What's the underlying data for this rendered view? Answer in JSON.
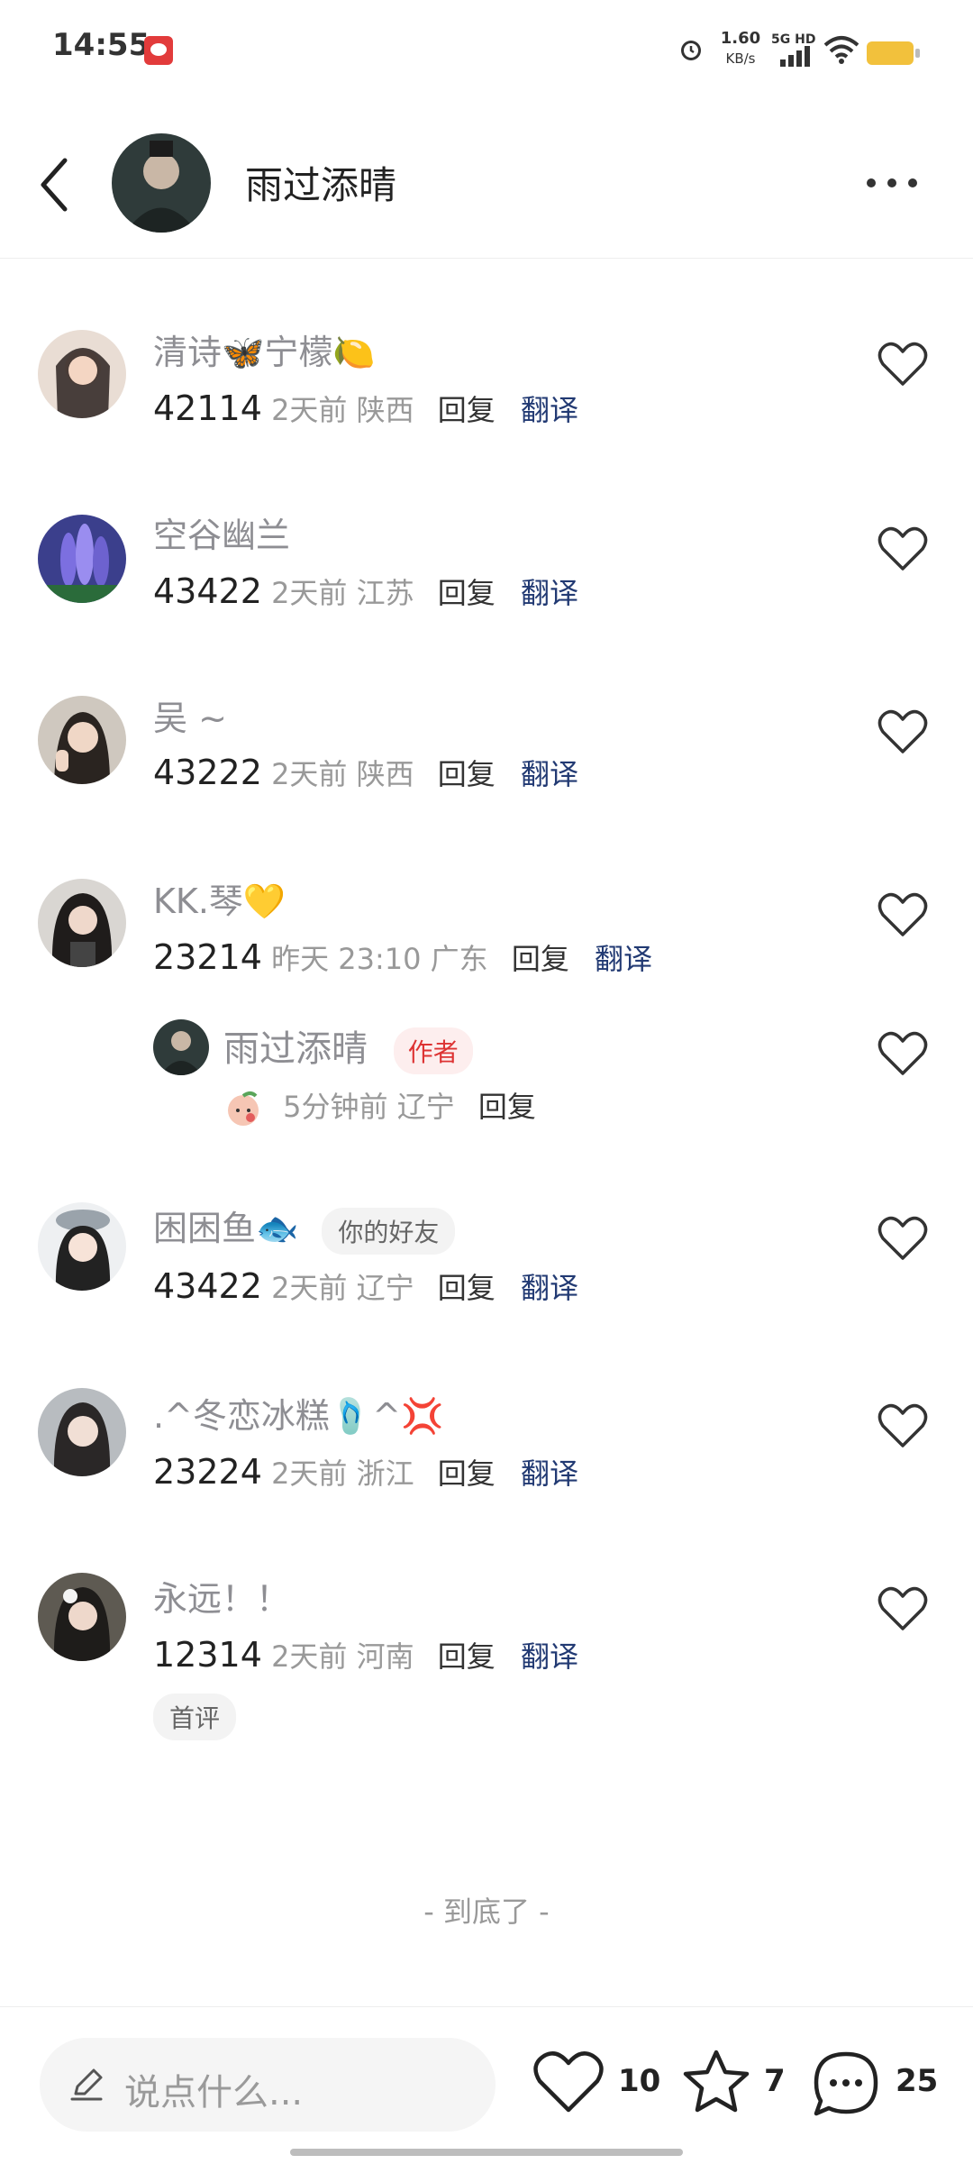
{
  "status_bar": {
    "time": "14:55",
    "net_speed_value": "1.60",
    "net_speed_unit": "KB/s",
    "network_label": "5G HD",
    "icons": [
      "app-icon",
      "alarm-icon",
      "signal-icon",
      "wifi-icon",
      "battery-icon"
    ]
  },
  "header": {
    "title": "雨过添晴",
    "icons": [
      "back-icon",
      "more-icon"
    ]
  },
  "comments": [
    {
      "name": "清诗🦋宁檬🍋",
      "count": "42114",
      "meta": "2天前 陕西",
      "reply": "回复",
      "translate": "翻译"
    },
    {
      "name": "空谷幽兰",
      "count": "43422",
      "meta": "2天前 江苏",
      "reply": "回复",
      "translate": "翻译"
    },
    {
      "name": "吴 ~",
      "count": "43222",
      "meta": "2天前 陕西",
      "reply": "回复",
      "translate": "翻译"
    },
    {
      "name": "KK.琴💛",
      "count": "23214",
      "meta": "昨天 23:10 广东",
      "reply": "回复",
      "translate": "翻译"
    },
    {
      "name": "困困鱼🐟",
      "tag": "你的好友",
      "count": "43422",
      "meta": "2天前 辽宁",
      "reply": "回复",
      "translate": "翻译"
    },
    {
      "name": ".^冬恋冰糕🩴^💢",
      "count": "23224",
      "meta": "2天前 浙江",
      "reply": "回复",
      "translate": "翻译"
    },
    {
      "name": "永远！！",
      "count": "12314",
      "meta": "2天前 河南",
      "reply": "回复",
      "translate": "翻译",
      "badge": "首评"
    }
  ],
  "reply": {
    "name": "雨过添晴",
    "tag": "作者",
    "meta": "5分钟前 辽宁",
    "reply": "回复"
  },
  "end_text": "- 到底了 -",
  "bottom_bar": {
    "placeholder": "说点什么...",
    "like_count": "10",
    "star_count": "7",
    "comment_count": "25"
  },
  "colors": {
    "translate": "#223a73",
    "author_tag": "#dd3333",
    "battery": "#f2c13c"
  }
}
